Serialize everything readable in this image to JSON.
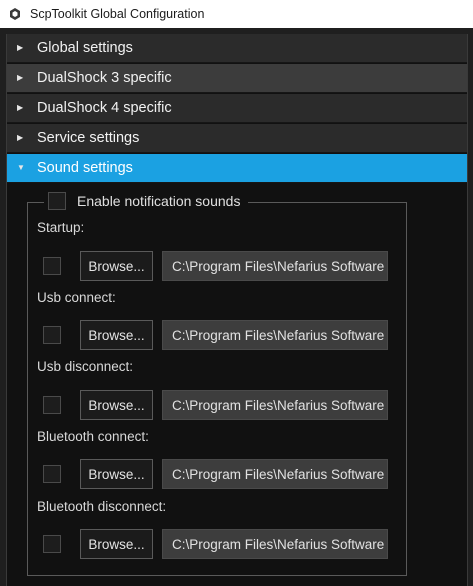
{
  "window": {
    "title": "ScpToolkit Global Configuration"
  },
  "sections": [
    {
      "label": "Global settings",
      "expanded": false
    },
    {
      "label": "DualShock 3 specific",
      "expanded": false
    },
    {
      "label": "DualShock 4 specific",
      "expanded": false
    },
    {
      "label": "Service settings",
      "expanded": false
    },
    {
      "label": "Sound settings",
      "expanded": true
    }
  ],
  "colors": {
    "accent": "#1ba1e2",
    "background": "#111111"
  },
  "icons": {
    "collapsed": "triangle-right",
    "expanded": "triangle-down"
  },
  "sound": {
    "enable_label": "Enable notification sounds",
    "enable_checked": false,
    "browse_label": "Browse...",
    "items": [
      {
        "label": "Startup:",
        "path": "C:\\Program Files\\Nefarius Software Solutions\\ScpToolkit",
        "checked": false
      },
      {
        "label": "Usb connect:",
        "path": "C:\\Program Files\\Nefarius Software Solutions\\ScpToolkit",
        "checked": false
      },
      {
        "label": "Usb disconnect:",
        "path": "C:\\Program Files\\Nefarius Software Solutions\\ScpToolkit",
        "checked": false
      },
      {
        "label": "Bluetooth connect:",
        "path": "C:\\Program Files\\Nefarius Software Solutions\\ScpToolkit",
        "checked": false
      },
      {
        "label": "Bluetooth disconnect:",
        "path": "C:\\Program Files\\Nefarius Software Solutions\\ScpToolkit",
        "checked": false
      }
    ]
  }
}
